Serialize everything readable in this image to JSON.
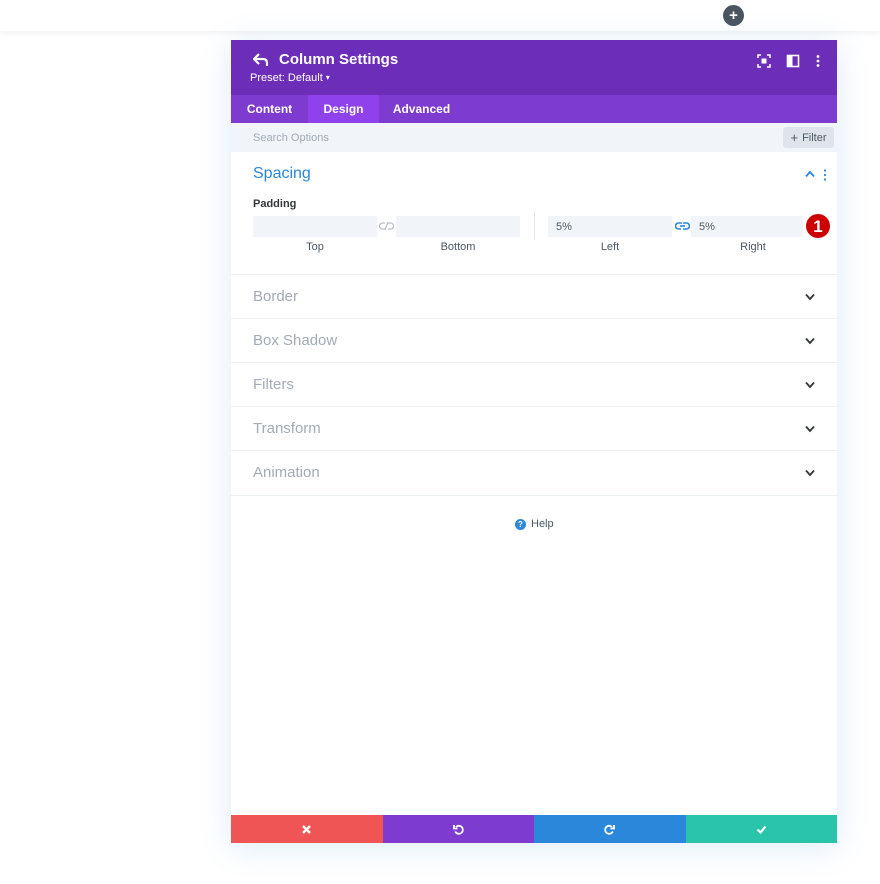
{
  "builder": {
    "add_section_icon": "plus-icon"
  },
  "modal": {
    "title": "Column Settings",
    "preset_label": "Preset: Default",
    "header_icons": [
      "back-icon",
      "fullscreen-icon",
      "split-view-icon",
      "more-vertical-icon"
    ]
  },
  "tabs": [
    {
      "label": "Content",
      "active": false
    },
    {
      "label": "Design",
      "active": true
    },
    {
      "label": "Advanced",
      "active": false
    }
  ],
  "search": {
    "placeholder": "Search Options",
    "filter_label": "Filter"
  },
  "spacing": {
    "title": "Spacing",
    "expanded": true,
    "padding_label": "Padding",
    "top": {
      "caption": "Top",
      "value": ""
    },
    "bottom": {
      "caption": "Bottom",
      "value": ""
    },
    "left": {
      "caption": "Left",
      "value": "5%"
    },
    "right": {
      "caption": "Right",
      "value": "5%"
    },
    "top_bottom_linked": false,
    "left_right_linked": true,
    "step_badge": "1"
  },
  "groups": [
    {
      "label": "Border"
    },
    {
      "label": "Box Shadow"
    },
    {
      "label": "Filters"
    },
    {
      "label": "Transform"
    },
    {
      "label": "Animation"
    }
  ],
  "help": {
    "label": "Help"
  },
  "footer": {
    "buttons": [
      {
        "name": "cancel",
        "icon": "close-icon",
        "color": "#ef5555"
      },
      {
        "name": "undo",
        "icon": "undo-icon",
        "color": "#7e3bd0"
      },
      {
        "name": "redo",
        "icon": "redo-icon",
        "color": "#2b87da"
      },
      {
        "name": "save",
        "icon": "check-icon",
        "color": "#29c4a9"
      }
    ]
  },
  "colors": {
    "header": "#6c2eb9",
    "tabs_bar": "#7e3bd0",
    "active_tab": "#8f42ec",
    "accent_blue": "#2b87da",
    "badge_red": "#cc0000"
  }
}
